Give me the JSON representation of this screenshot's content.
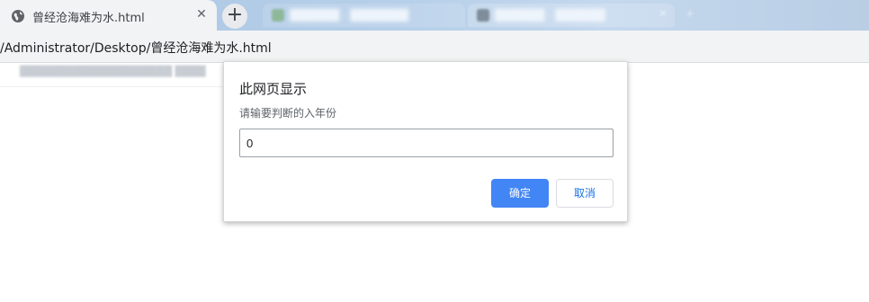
{
  "browser": {
    "active_tab": {
      "title": "曾经沧海难为水.html",
      "icon": "globe-icon",
      "close_glyph": "✕"
    },
    "new_tab_glyph": "+",
    "background_tabs": [
      {
        "title": "██████ - ███████",
        "icon": "favicon-green"
      },
      {
        "title": "██████ - ██████",
        "icon": "favicon-gray"
      }
    ],
    "address": "/Administrator/Desktop/曾经沧海难为水.html"
  },
  "page": {
    "hint_text": "████████████████████ ████"
  },
  "dialog": {
    "title": "此网页显示",
    "message": "请输要判断的入年份",
    "input_value": "0",
    "ok_label": "确定",
    "cancel_label": "取消"
  },
  "colors": {
    "ok_button": "#4285f4",
    "cancel_text": "#1a73e8",
    "tabstrip": "#b6cfe9"
  }
}
